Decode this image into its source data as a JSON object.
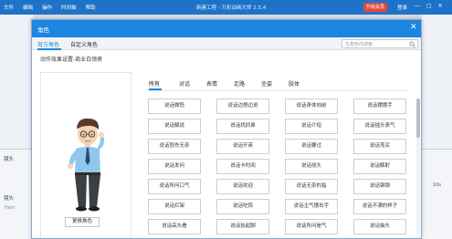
{
  "app": {
    "menu": [
      "文件",
      "编辑",
      "操作",
      "时间轴",
      "帮助"
    ],
    "title": "新建工程 - 万彩动画大师 2.5.4",
    "upgrade_label": "升级会员",
    "login_label": "登录",
    "win_buttons": [
      "—",
      "□",
      "✕"
    ],
    "left_label_a": "镜头",
    "left_label_b": "镜头",
    "left_label_c": "Fam",
    "zoom": "10s"
  },
  "dialog": {
    "title": "角色",
    "close": "✕",
    "tabs": [
      "官方角色",
      "自定义角色"
    ],
    "search_placeholder": "在角色内搜索",
    "subtitle": "动作效果设置-商业白领男",
    "change_button": "更换角色",
    "categories": [
      "所有",
      "对话",
      "表情",
      "走路",
      "坐姿",
      "肢体"
    ],
    "actions": [
      "说话微怒",
      "说话边想边说",
      "说话身体向前",
      "说话摆摆手",
      "说话解说",
      "说话找抓鼻",
      "说话介绍",
      "说话插头表气",
      "说话怒伤无奈",
      "说话开英",
      "说话要过",
      "说话弯买",
      "说话发问",
      "说话卡时间",
      "说话挠头",
      "说话解射",
      "说话所问口气",
      "说话欢迎",
      "说话无奈的指",
      "说话钢钢",
      "说话拦架",
      "说话吃惊",
      "说话主气摆右手",
      "说话不满的样子",
      "说话高头看",
      "说话抬起脚",
      "说话所问是气",
      "说话抽头"
    ]
  },
  "colors": {
    "titlebar": "#1e73c9",
    "dialog_title": "#1c86e0",
    "upgrade": "#e24a3b"
  }
}
